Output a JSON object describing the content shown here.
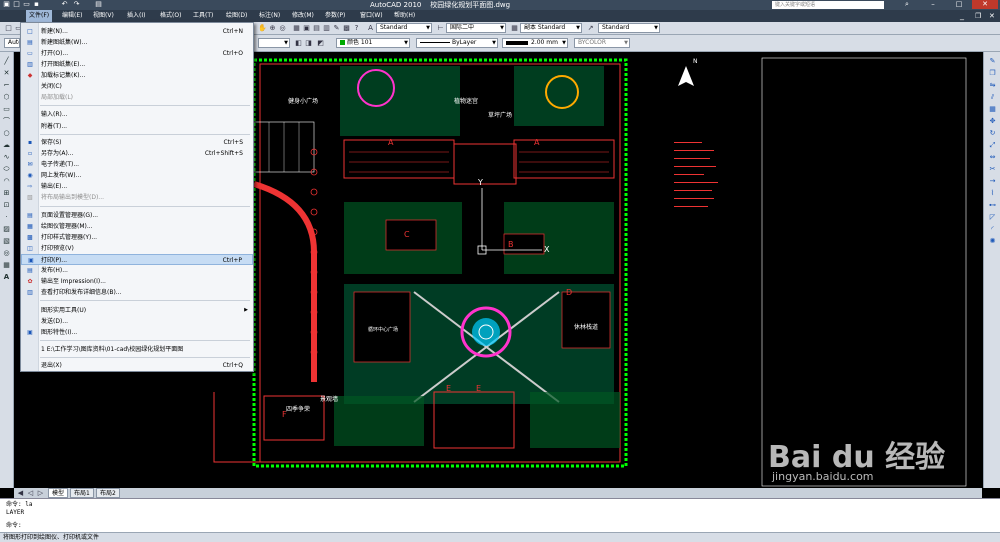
{
  "app": {
    "title": "AutoCAD 2010",
    "document": "校园绿化规划平面图.dwg",
    "search_placeholder": "键入关键字或短语"
  },
  "menubar": [
    "文件(F)",
    "编辑(E)",
    "视图(V)",
    "插入(I)",
    "格式(O)",
    "工具(T)",
    "绘图(D)",
    "标注(N)",
    "修改(M)",
    "参数(P)",
    "窗口(W)",
    "帮助(H)"
  ],
  "toolbar": {
    "workspace": "Auto",
    "style1": "Standard",
    "style2": "国际二中",
    "style3": "副本 Standard",
    "style4": "Standard",
    "color": "颜色 101",
    "linetype": "ByLayer",
    "lineweight": "2.00 mm",
    "plotstyle": "BYCOLOR"
  },
  "file_menu": {
    "items": [
      {
        "label": "新建(N)...",
        "shortcut": "Ctrl+N"
      },
      {
        "label": "新建图纸集(W)...",
        "shortcut": ""
      },
      {
        "label": "打开(O)...",
        "shortcut": "Ctrl+O"
      },
      {
        "label": "打开图纸集(E)...",
        "shortcut": ""
      },
      {
        "label": "加载标记集(K)...",
        "shortcut": ""
      },
      {
        "label": "关闭(C)",
        "shortcut": ""
      },
      {
        "label": "局部加载(L)",
        "shortcut": ""
      },
      {
        "label": "输入(R)...",
        "shortcut": ""
      },
      {
        "label": "附着(T)...",
        "shortcut": ""
      },
      {
        "label": "保存(S)",
        "shortcut": "Ctrl+S"
      },
      {
        "label": "另存为(A)...",
        "shortcut": "Ctrl+Shift+S"
      },
      {
        "label": "电子传递(T)...",
        "shortcut": ""
      },
      {
        "label": "网上发布(W)...",
        "shortcut": ""
      },
      {
        "label": "输出(E)...",
        "shortcut": ""
      },
      {
        "label": "将布局输出到模型(D)...",
        "shortcut": ""
      },
      {
        "label": "页面设置管理器(G)...",
        "shortcut": ""
      },
      {
        "label": "绘图仪管理器(M)...",
        "shortcut": ""
      },
      {
        "label": "打印样式管理器(Y)...",
        "shortcut": ""
      },
      {
        "label": "打印预览(V)",
        "shortcut": ""
      },
      {
        "label": "打印(P)...",
        "shortcut": "Ctrl+P"
      },
      {
        "label": "发布(H)...",
        "shortcut": ""
      },
      {
        "label": "输出至 Impression(I)...",
        "shortcut": ""
      },
      {
        "label": "查看打印和发布详细信息(B)...",
        "shortcut": ""
      },
      {
        "label": "图形实用工具(U)",
        "shortcut": ""
      },
      {
        "label": "发送(D)...",
        "shortcut": ""
      },
      {
        "label": "图形特性(I)...",
        "shortcut": ""
      },
      {
        "label": "1 E:\\工作学习\\图库资料\\01-cad\\校园绿化规划平面图",
        "shortcut": ""
      },
      {
        "label": "退出(X)",
        "shortcut": "Ctrl+Q"
      }
    ]
  },
  "drawing_labels": {
    "fitness": "健身小广场",
    "maze": "植物迷宫",
    "lawn": "草坪广场",
    "loop": "循环中心广场",
    "forest": "休林栈道",
    "wall": "景观墙",
    "seasons": "四季争荣",
    "letter_a": "A",
    "letter_b": "B",
    "letter_c": "C",
    "letter_d": "D",
    "letter_e": "E",
    "letter_f": "F",
    "axis_y": "Y",
    "axis_x": "X",
    "north": "N"
  },
  "layout_tabs": [
    "模型",
    "布局1",
    "布局2"
  ],
  "command_lines": [
    "命令: la",
    "LAYER",
    "命令:"
  ],
  "status": "将图形打印到绘图仪、打印机或文件",
  "watermark": {
    "brand": "Bai du 经验",
    "url": "jingyan.baidu.com"
  }
}
